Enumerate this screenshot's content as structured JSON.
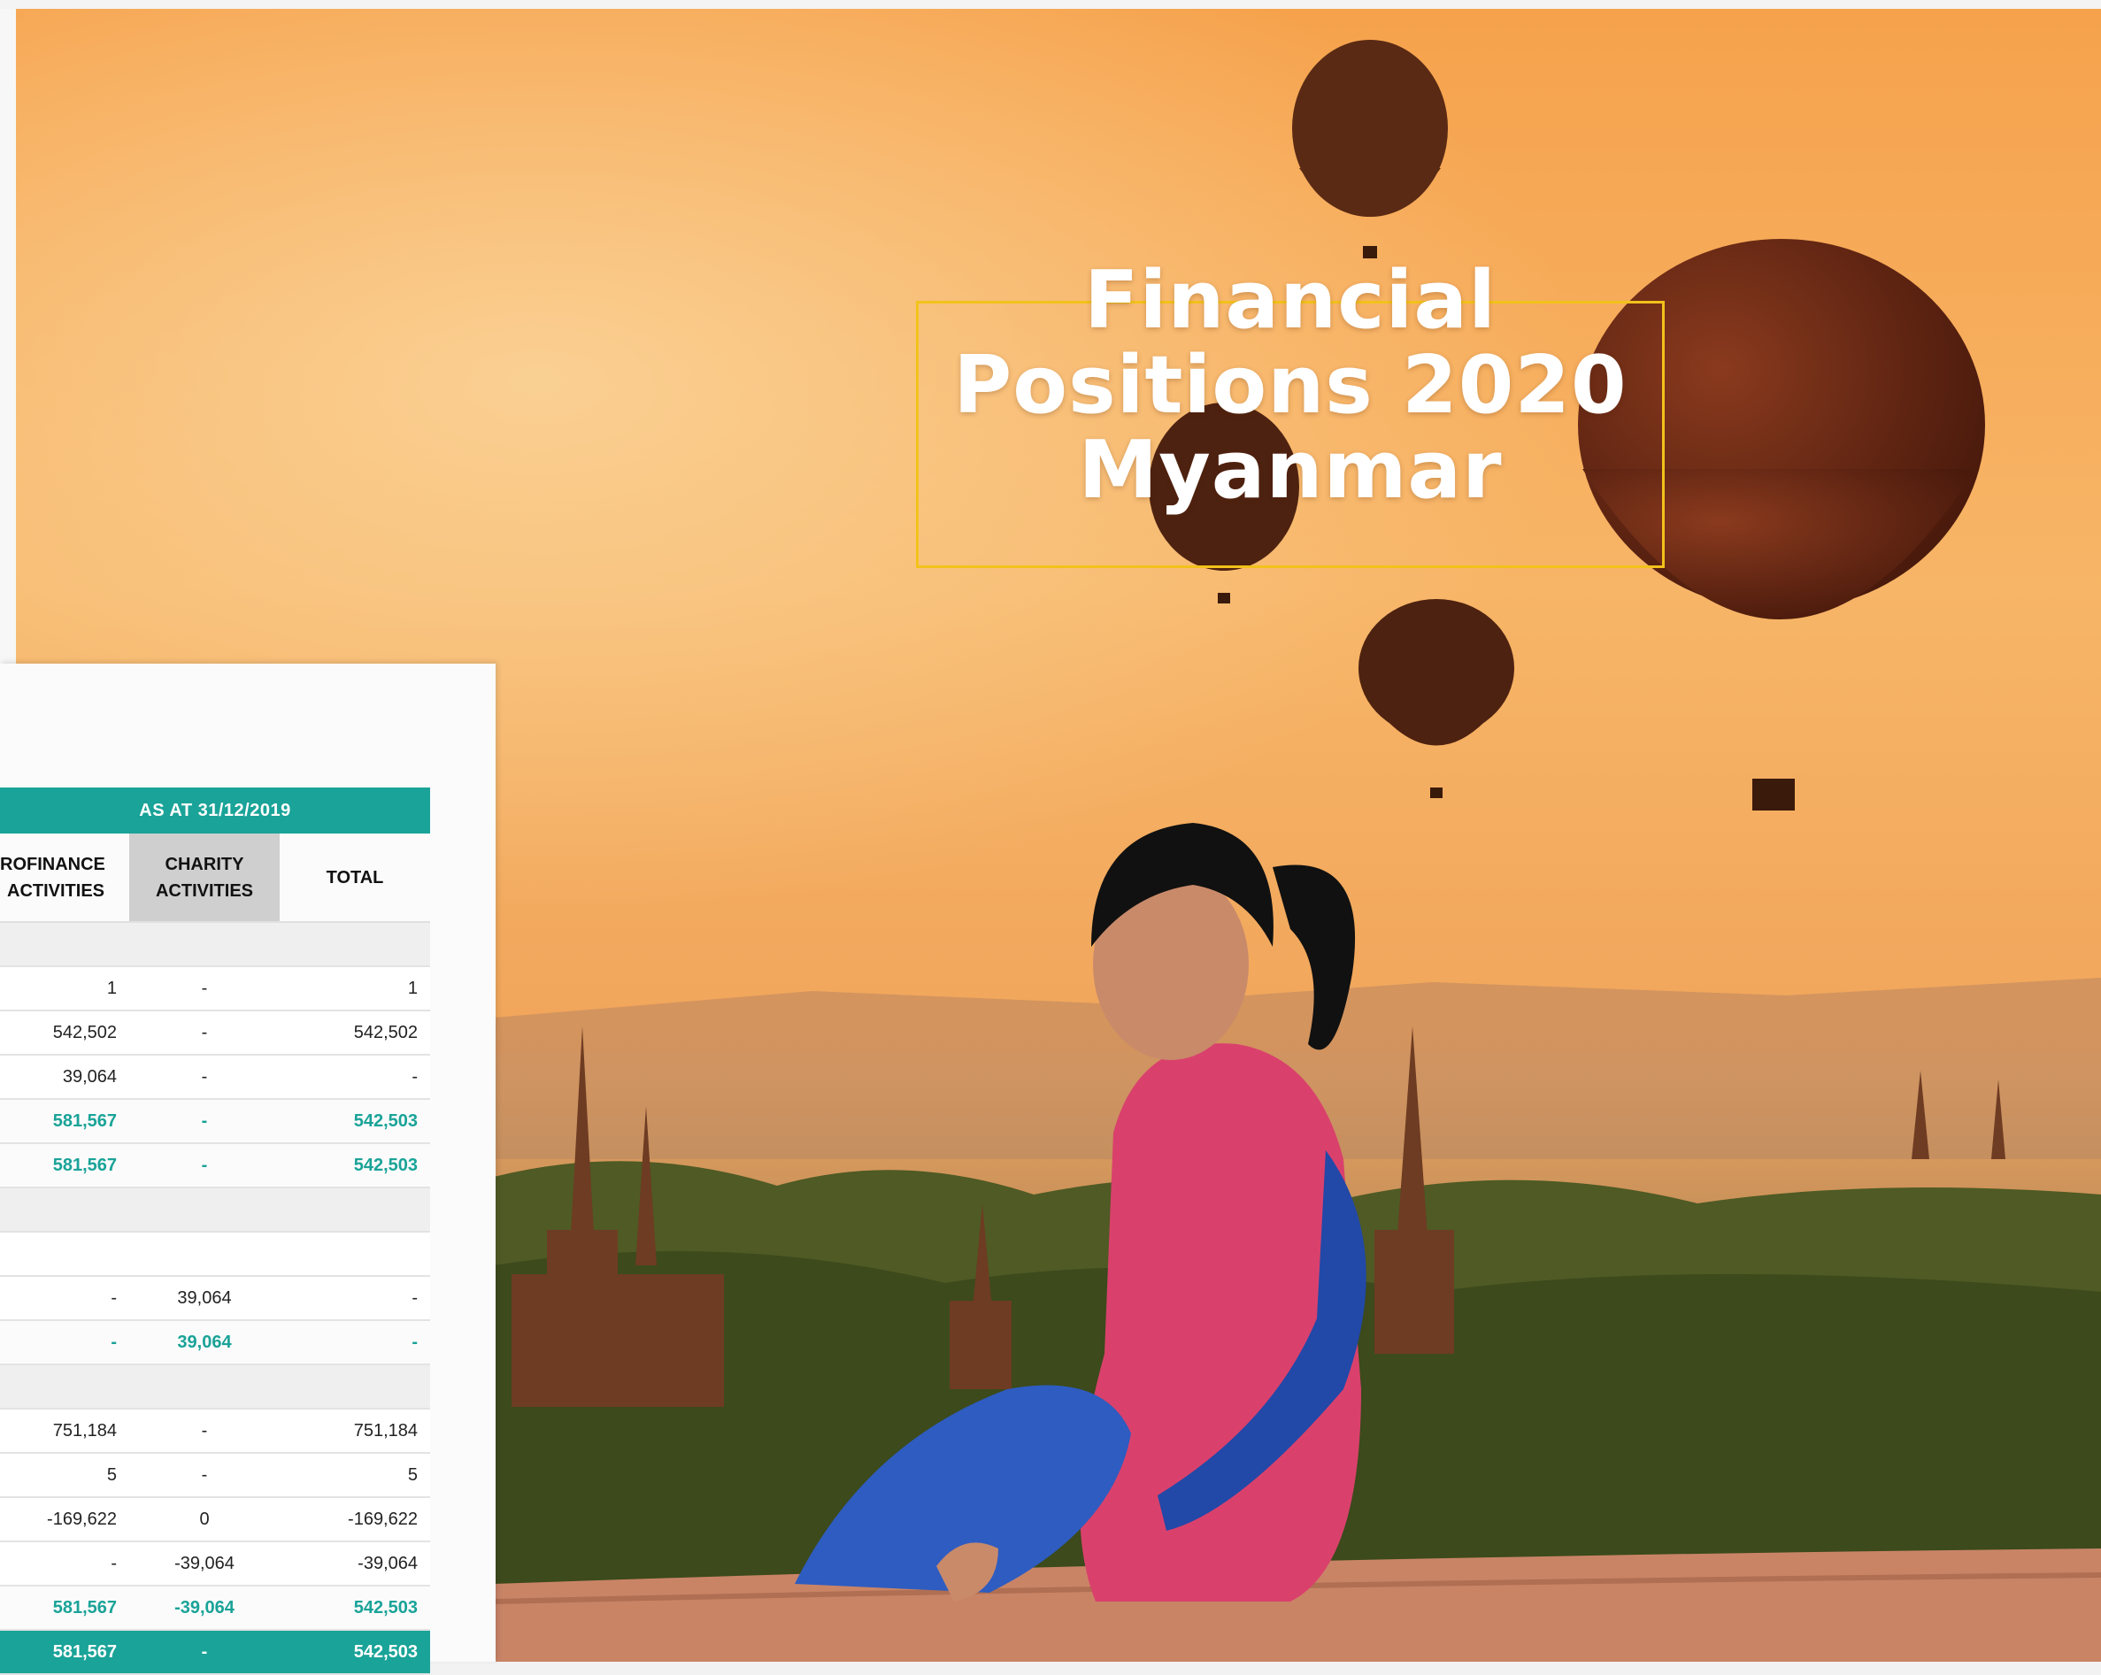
{
  "title": {
    "line1": "Financial",
    "line2": "Positions 2020",
    "line3": "Myanmar"
  },
  "colors": {
    "accent": "#1aa398",
    "title_frame": "#f2c21b",
    "sky": "#f5a04a"
  },
  "table": {
    "period_header": "AS AT 31/12/2019",
    "columns": [
      {
        "line1": "ROFINANCE",
        "line2": "ACTIVITIES"
      },
      {
        "line1": "CHARITY",
        "line2": "ACTIVITIES"
      },
      {
        "label": "TOTAL"
      }
    ],
    "rows": [
      {
        "style": "blank",
        "cells": [
          "",
          "",
          ""
        ]
      },
      {
        "style": "white",
        "cells": [
          "1",
          "-",
          "1"
        ]
      },
      {
        "style": "white",
        "cells": [
          "542,502",
          "-",
          "542,502"
        ]
      },
      {
        "style": "white",
        "cells": [
          "39,064",
          "-",
          "-"
        ]
      },
      {
        "style": "bold",
        "cells": [
          "581,567",
          "-",
          "542,503"
        ]
      },
      {
        "style": "bold",
        "cells": [
          "581,567",
          "-",
          "542,503"
        ]
      },
      {
        "style": "blank",
        "cells": [
          "",
          "",
          ""
        ]
      },
      {
        "style": "white",
        "cells": [
          "",
          "",
          ""
        ]
      },
      {
        "style": "white",
        "cells": [
          "-",
          "39,064",
          "-"
        ]
      },
      {
        "style": "bold",
        "cells": [
          "-",
          "39,064",
          "-"
        ]
      },
      {
        "style": "blank",
        "cells": [
          "",
          "",
          ""
        ]
      },
      {
        "style": "white",
        "cells": [
          "751,184",
          "-",
          "751,184"
        ]
      },
      {
        "style": "white",
        "cells": [
          "5",
          "-",
          "5"
        ]
      },
      {
        "style": "white",
        "cells": [
          "-169,622",
          "0",
          "-169,622"
        ]
      },
      {
        "style": "white",
        "cells": [
          "-",
          "-39,064",
          "-39,064"
        ]
      },
      {
        "style": "bold",
        "cells": [
          "581,567",
          "-39,064",
          "542,503"
        ]
      },
      {
        "style": "final",
        "cells": [
          "581,567",
          "-",
          "542,503"
        ]
      }
    ]
  }
}
